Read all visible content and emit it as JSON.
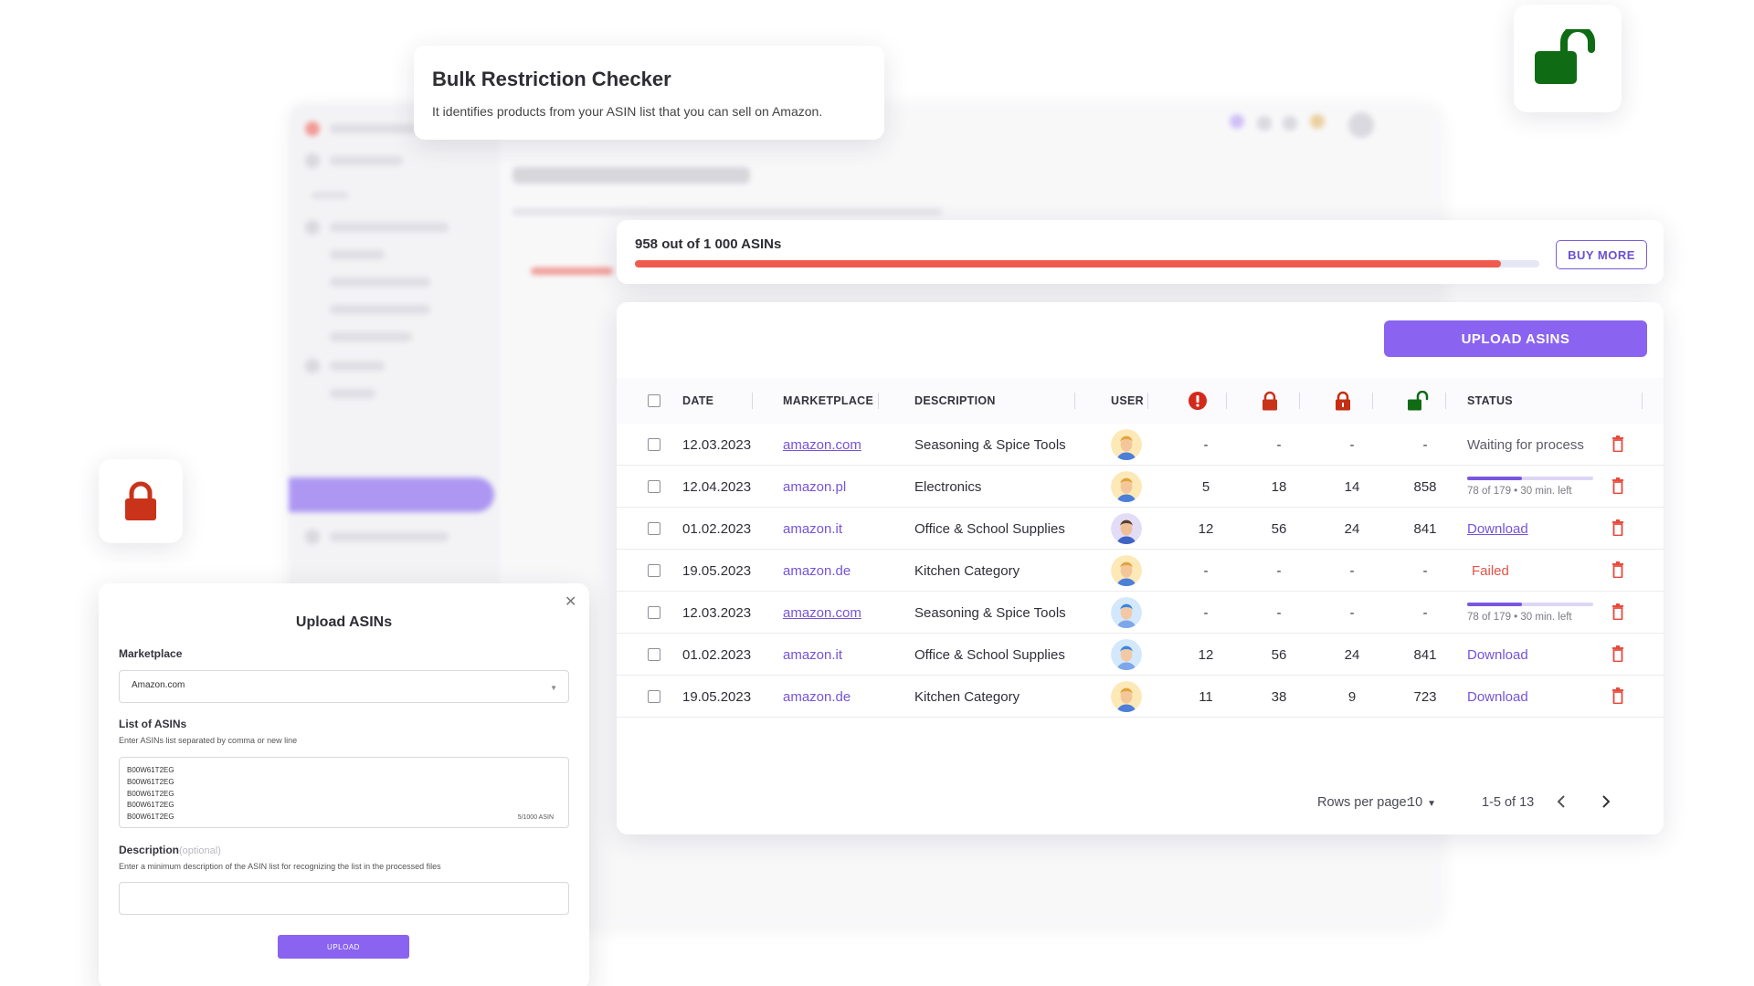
{
  "title_card": {
    "title": "Bulk Restriction Checker",
    "subtitle": "It identifies products from your ASIN list that you can sell on Amazon."
  },
  "progress": {
    "text": "958 out of 1 000 ASINs",
    "used": 958,
    "total": 1000,
    "buy_more_label": "BUY MORE",
    "bar_color": "#ef5b4f"
  },
  "table": {
    "upload_label": "UPLOAD ASINS",
    "headers": {
      "date": "DATE",
      "marketplace": "MARKETPLACE",
      "description": "DESCRIPTION",
      "user": "USER",
      "status": "STATUS"
    },
    "header_icons": [
      "alert-icon",
      "lock-red-icon",
      "lock-orange-icon",
      "unlock-green-icon"
    ],
    "rows": [
      {
        "date": "12.03.2023",
        "marketplace": "amazon.com",
        "description": "Seasoning & Spice Tools",
        "avatar": "male-blond",
        "c1": "-",
        "c2": "-",
        "c3": "-",
        "c4": "-",
        "status": {
          "type": "text",
          "text": "Waiting for process"
        }
      },
      {
        "date": "12.04.2023",
        "marketplace": "amazon.pl",
        "description": "Electronics",
        "avatar": "male-blond",
        "c1": "5",
        "c2": "18",
        "c3": "14",
        "c4": "858",
        "status": {
          "type": "progress",
          "progress": 0.436,
          "text": "78 of 179 • 30 min. left"
        }
      },
      {
        "date": "01.02.2023",
        "marketplace": "amazon.it",
        "description": "Office & School Supplies",
        "avatar": "male-dark",
        "c1": "12",
        "c2": "56",
        "c3": "24",
        "c4": "841",
        "status": {
          "type": "link",
          "text": "Download"
        }
      },
      {
        "date": "19.05.2023",
        "marketplace": "amazon.de",
        "description": "Kitchen Category",
        "avatar": "male-blond",
        "c1": "-",
        "c2": "-",
        "c3": "-",
        "c4": "-",
        "status": {
          "type": "failed",
          "text": "Failed"
        }
      },
      {
        "date": "12.03.2023",
        "marketplace": "amazon.com",
        "description": "Seasoning & Spice Tools",
        "avatar": "female-blue",
        "c1": "-",
        "c2": "-",
        "c3": "-",
        "c4": "-",
        "status": {
          "type": "progress",
          "progress": 0.436,
          "text": "78 of 179 • 30 min. left"
        }
      },
      {
        "date": "01.02.2023",
        "marketplace": "amazon.it",
        "description": "Office & School Supplies",
        "avatar": "female-blue",
        "c1": "12",
        "c2": "56",
        "c3": "24",
        "c4": "841",
        "status": {
          "type": "link",
          "text": "Download"
        }
      },
      {
        "date": "19.05.2023",
        "marketplace": "amazon.de",
        "description": "Kitchen Category",
        "avatar": "male-blond",
        "c1": "11",
        "c2": "38",
        "c3": "9",
        "c4": "723",
        "status": {
          "type": "link",
          "text": "Download"
        }
      }
    ],
    "footer": {
      "rows_per_page_label": "Rows per page:",
      "rows_per_page_value": "10",
      "range": "1-5 of 13"
    }
  },
  "modal": {
    "title": "Upload ASINs",
    "marketplace_label": "Marketplace",
    "marketplace_value": "Amazon.com",
    "list_label": "List of ASINs",
    "list_help": "Enter ASINs list separated by comma or new line",
    "asins": "B00W61T2EG\nB00W61T2EG\nB00W61T2EG\nB00W61T2EG\nB00W61T2EG",
    "asin_count": "5/1000 ASIN",
    "description_label": "Description",
    "description_optional": "(optional)",
    "description_help": "Enter a minimum description of the ASIN list for recognizing the list in the processed files",
    "upload_label": "UPLOAD"
  },
  "colors": {
    "accent": "#8a63f0",
    "link": "#7653d8",
    "lock_red": "#c9331a",
    "unlock_green": "#0f6b14",
    "alert_red": "#d42a1b",
    "trash": "#e64a3b"
  }
}
